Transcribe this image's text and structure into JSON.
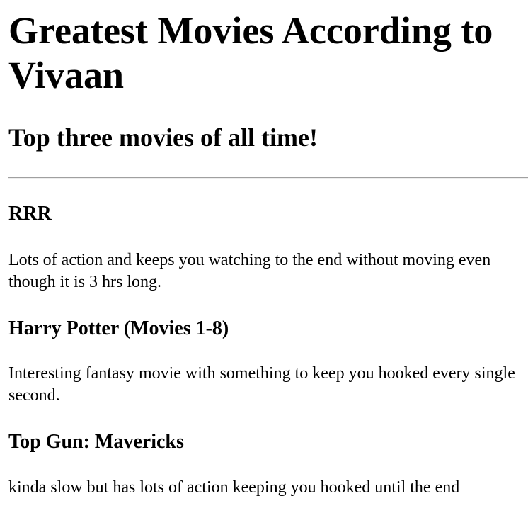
{
  "page": {
    "title": "Greatest Movies According to Vivaan",
    "subtitle": "Top three movies of all time!"
  },
  "movies": [
    {
      "title": "RRR",
      "description": "Lots of action and keeps you watching to the end without moving even though it is 3 hrs long."
    },
    {
      "title": "Harry Potter (Movies 1-8)",
      "description": "Interesting fantasy movie with something to keep you hooked every single second."
    },
    {
      "title": "Top Gun: Mavericks",
      "description": "kinda slow but has lots of action keeping you hooked until the end"
    }
  ]
}
